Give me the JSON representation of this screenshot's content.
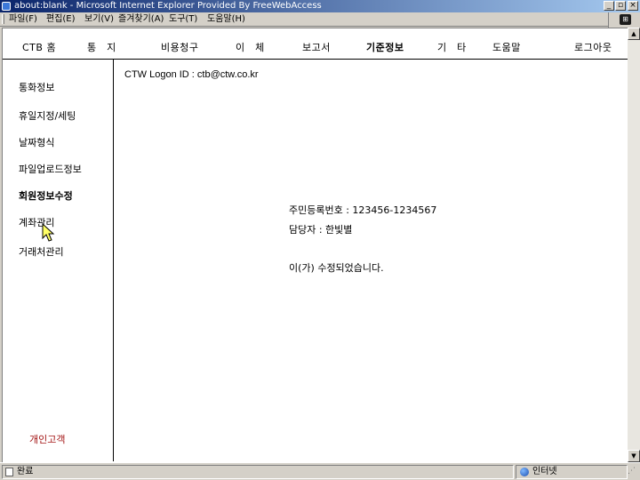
{
  "window": {
    "title": "about:blank - Microsoft Internet Explorer Provided By FreeWebAccess",
    "minimize": "_",
    "maximize": "▫",
    "close": "×"
  },
  "menubar": {
    "items": [
      "파일(F)",
      "편집(E)",
      "보기(V)",
      "즐겨찾기(A)",
      "도구(T)",
      "도움말(H)"
    ]
  },
  "top_nav": {
    "items": [
      "CTB 홈",
      "통　지",
      "비용청구",
      "이　체",
      "보고서",
      "기준정보",
      "기　타",
      "도움말",
      "로그아웃"
    ],
    "active_index": 5
  },
  "sidebar": {
    "items": [
      "통화정보",
      "휴일지정/세팅",
      "날짜형식",
      "파일업로드정보",
      "회원정보수정",
      "계좌관리",
      "거래처관리"
    ],
    "active_index": 4,
    "footer": "개인고객"
  },
  "content": {
    "logon_label": "CTW Logon ID : ctb@ctw.co.kr",
    "resident_id": "주민등록번호 : 123456-1234567",
    "manager": "담당자 : 한빛별",
    "message": "이(가) 수정되었습니다."
  },
  "statusbar": {
    "text": "완료",
    "zone": "인터넷"
  },
  "colors": {
    "titlebar_start": "#0a246a",
    "titlebar_end": "#a6caf0",
    "footer_link": "#a31515",
    "chrome": "#d4d0c8"
  }
}
